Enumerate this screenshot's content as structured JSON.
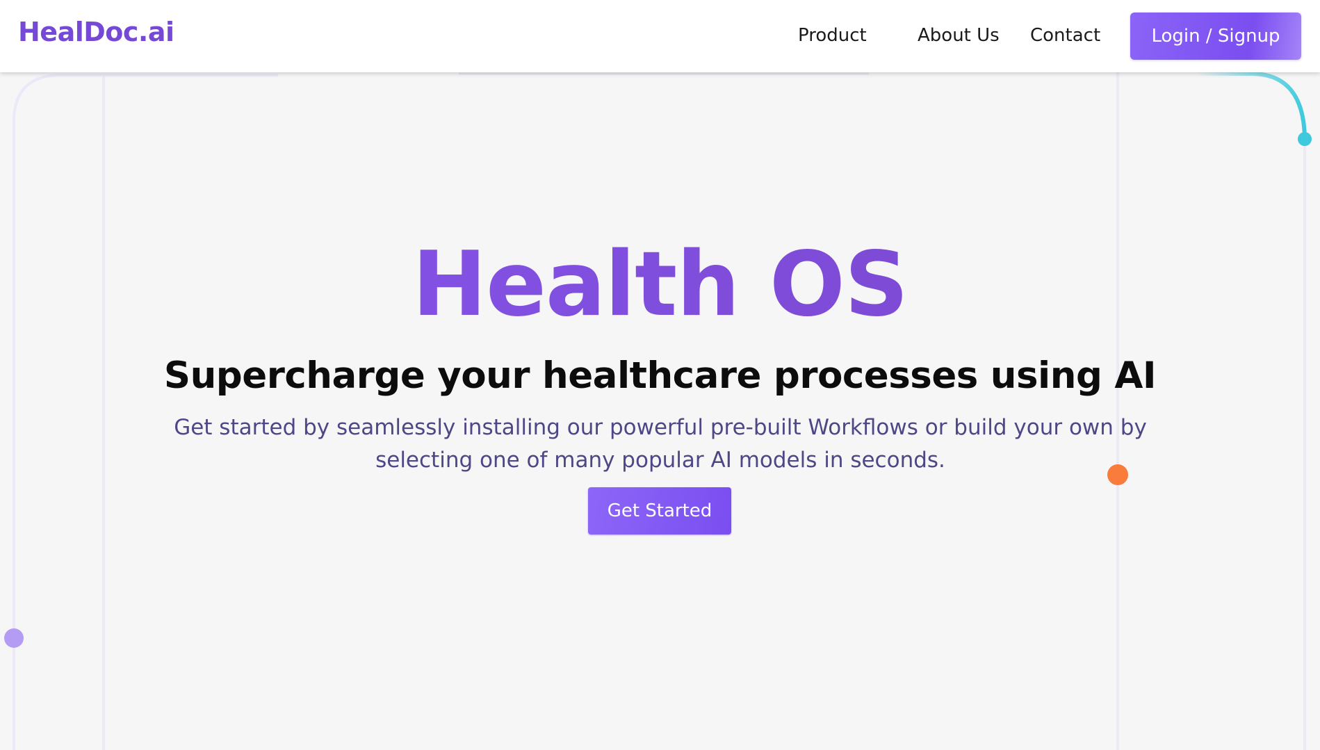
{
  "nav": {
    "logo": "HealDoc.ai",
    "links": [
      {
        "label": "Product"
      },
      {
        "label": "About Us"
      },
      {
        "label": "Contact"
      }
    ],
    "login_label": "Login / Signup"
  },
  "hero": {
    "title": "Health OS",
    "subtitle": "Supercharge your healthcare processes using AI",
    "description": "Get started by seamlessly installing our powerful pre-built Workflows or build your own by selecting one of many popular AI models in seconds.",
    "cta_label": "Get Started"
  },
  "colors": {
    "brand_purple": "#7b4ef0",
    "accent_orange": "#f97c3c",
    "accent_cyan": "#3ec9dc",
    "background": "#f6f6f7"
  }
}
